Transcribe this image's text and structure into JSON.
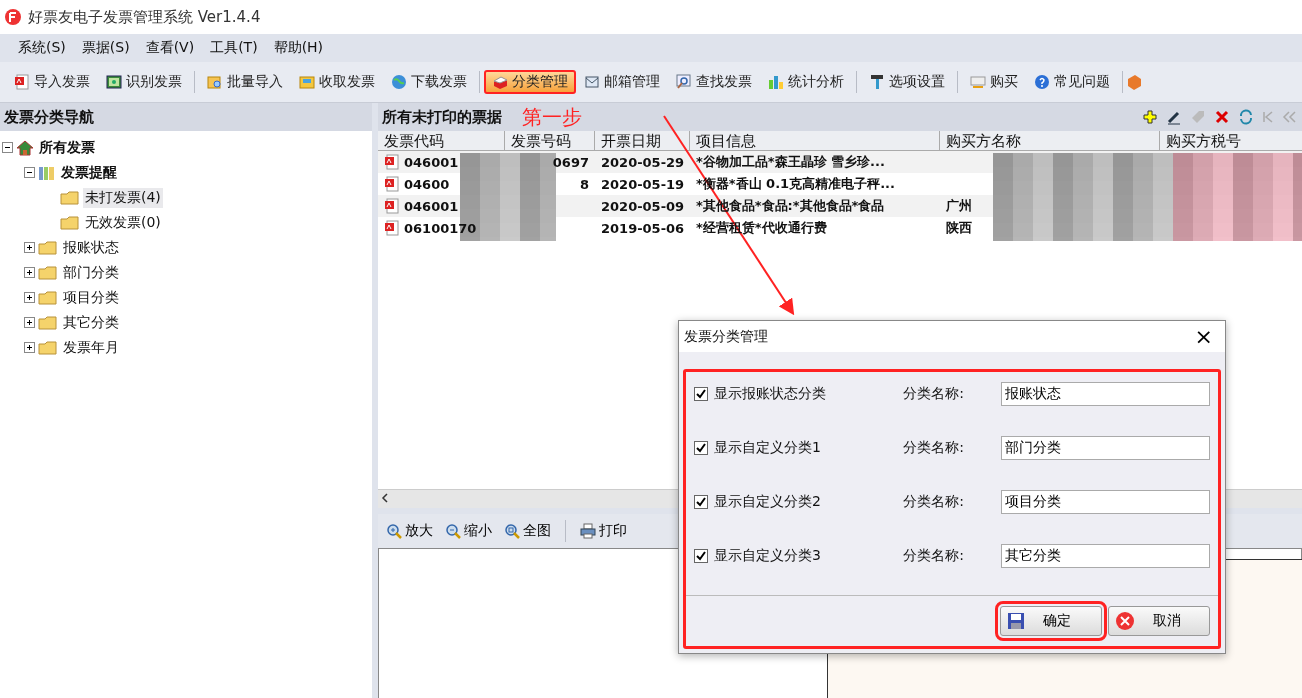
{
  "window": {
    "title": "好票友电子发票管理系统 Ver1.4.4"
  },
  "menu": [
    "系统(S)",
    "票据(S)",
    "查看(V)",
    "工具(T)",
    "帮助(H)"
  ],
  "toolbar": {
    "groups": [
      [
        {
          "label": "导入发票",
          "highlighted": false
        },
        {
          "label": "识别发票",
          "highlighted": false
        }
      ],
      [
        {
          "label": "批量导入",
          "highlighted": false
        },
        {
          "label": "收取发票",
          "highlighted": false
        },
        {
          "label": "下载发票",
          "highlighted": false
        }
      ],
      [
        {
          "label": "分类管理",
          "highlighted": true
        },
        {
          "label": "邮箱管理",
          "highlighted": false
        },
        {
          "label": "查找发票",
          "highlighted": false
        },
        {
          "label": "统计分析",
          "highlighted": false
        }
      ],
      [
        {
          "label": "选项设置",
          "highlighted": false
        }
      ],
      [
        {
          "label": "购买",
          "highlighted": false
        },
        {
          "label": "常见问题",
          "highlighted": false
        }
      ]
    ]
  },
  "nav": {
    "title": "发票分类导航",
    "tree": [
      {
        "label": "所有发票",
        "kind": "root",
        "expanded": true,
        "selected": false,
        "children": [
          {
            "label": "发票提醒",
            "kind": "books",
            "expanded": true,
            "selected": false,
            "children": [
              {
                "label": "未打发票(4)",
                "kind": "leaf",
                "selected": true
              },
              {
                "label": "无效发票(0)",
                "kind": "leaf",
                "selected": false
              }
            ]
          },
          {
            "label": "报账状态",
            "kind": "folder",
            "expanded": false,
            "selected": false
          },
          {
            "label": "部门分类",
            "kind": "folder",
            "expanded": false,
            "selected": false
          },
          {
            "label": "项目分类",
            "kind": "folder",
            "expanded": false,
            "selected": false
          },
          {
            "label": "其它分类",
            "kind": "folder",
            "expanded": false,
            "selected": false
          },
          {
            "label": "发票年月",
            "kind": "folder",
            "expanded": false,
            "selected": false
          }
        ]
      }
    ]
  },
  "list": {
    "title": "所有未打印的票据",
    "annotation": "第一步",
    "columns": [
      "发票代码",
      "发票号码",
      "开票日期",
      "项目信息",
      "购买方名称",
      "购买方税号"
    ],
    "rows": [
      {
        "code": "046001",
        "number": "0697",
        "date": "2020-05-29",
        "item": "*谷物加工品*森王晶珍 雪乡珍..."
      },
      {
        "code": "04600",
        "number": "8",
        "date": "2020-05-19",
        "item": "*衡器*香山 0.1克高精准电子秤..."
      },
      {
        "code": "046001",
        "date": "2020-05-09",
        "item": "*其他食品*食品:*其他食品*食品",
        "buyer": "广州"
      },
      {
        "code": "06100170",
        "date": "2019-05-06",
        "item": "*经营租赁*代收通行费",
        "buyer": "陕西"
      }
    ]
  },
  "preview_toolbar": [
    "放大",
    "缩小",
    "全图",
    "打印"
  ],
  "dialog": {
    "title": "发票分类管理",
    "close": "×",
    "rows": [
      {
        "label": "显示报账状态分类",
        "checked": true,
        "name_label": "分类名称:",
        "value": "报账状态"
      },
      {
        "label": "显示自定义分类1",
        "checked": true,
        "name_label": "分类名称:",
        "value": "部门分类"
      },
      {
        "label": "显示自定义分类2",
        "checked": true,
        "name_label": "分类名称:",
        "value": "项目分类"
      },
      {
        "label": "显示自定义分类3",
        "checked": true,
        "name_label": "分类名称:",
        "value": "其它分类"
      }
    ],
    "buttons": [
      {
        "label": "确定",
        "kind": "ok",
        "highlighted": true
      },
      {
        "label": "取消",
        "kind": "cancel",
        "highlighted": false
      }
    ]
  }
}
